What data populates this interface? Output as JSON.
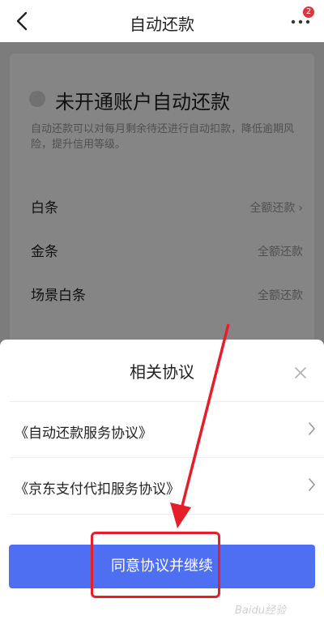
{
  "header": {
    "title": "自动还款",
    "notification_count": "2"
  },
  "background": {
    "card_title": "未开通账户自动还款",
    "card_desc": "自动还款可以对每月剩余待还进行自动扣款，降低逾期风险，提升信用等级。",
    "rows": [
      {
        "label": "白条",
        "value": "全额还款",
        "chevron": "›"
      },
      {
        "label": "金条",
        "value": "全额还款"
      },
      {
        "label": "场景白条",
        "value": "全额还款"
      }
    ]
  },
  "sheet": {
    "title": "相关协议",
    "agreements": [
      {
        "label": "《自动还款服务协议》"
      },
      {
        "label": "《京东支付代扣服务协议》"
      }
    ],
    "agree_button": "同意协议并继续"
  },
  "watermark": "Baidu经验",
  "colors": {
    "primary_button": "#4f6ff3",
    "annotation": "#e61e2a",
    "badge": "#e2323c"
  }
}
